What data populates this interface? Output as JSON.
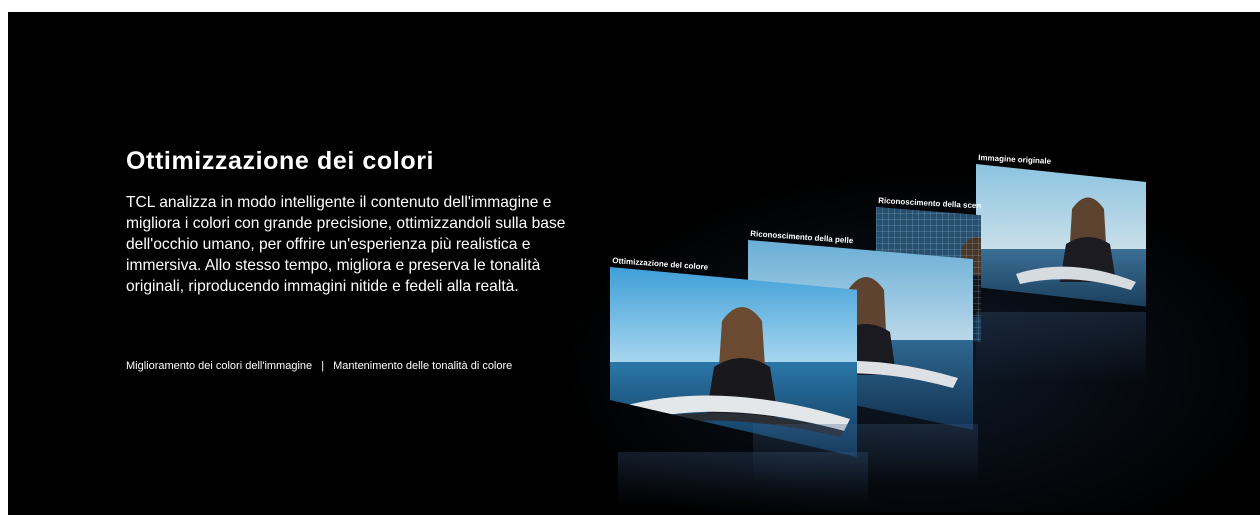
{
  "heading": "Ottimizzazione dei colori",
  "description": "TCL analizza in modo intelligente il contenuto dell'immagine e migliora i colori con grande precisione, ottimizzandoli sulla base dell'occhio umano, per offrire un'esperienza più realistica e immersiva.  Allo stesso tempo, migliora e preserva le tonalità originali, riproducendo immagini nitide e fedeli alla realtà.",
  "features": {
    "first": "Miglioramento dei colori dell'immagine",
    "separator": "|",
    "second": "Mantenimento delle tonalità di colore"
  },
  "panels": [
    {
      "caption": "Ottimizzazione del colore"
    },
    {
      "caption": "Riconoscimento della pelle"
    },
    {
      "caption": "Riconoscimento della scen"
    },
    {
      "caption": "Immagine originale"
    }
  ],
  "colors": {
    "background": "#000000",
    "text": "#ffffff",
    "sky": "#6fb4dc",
    "sea": "#1e4f78"
  }
}
